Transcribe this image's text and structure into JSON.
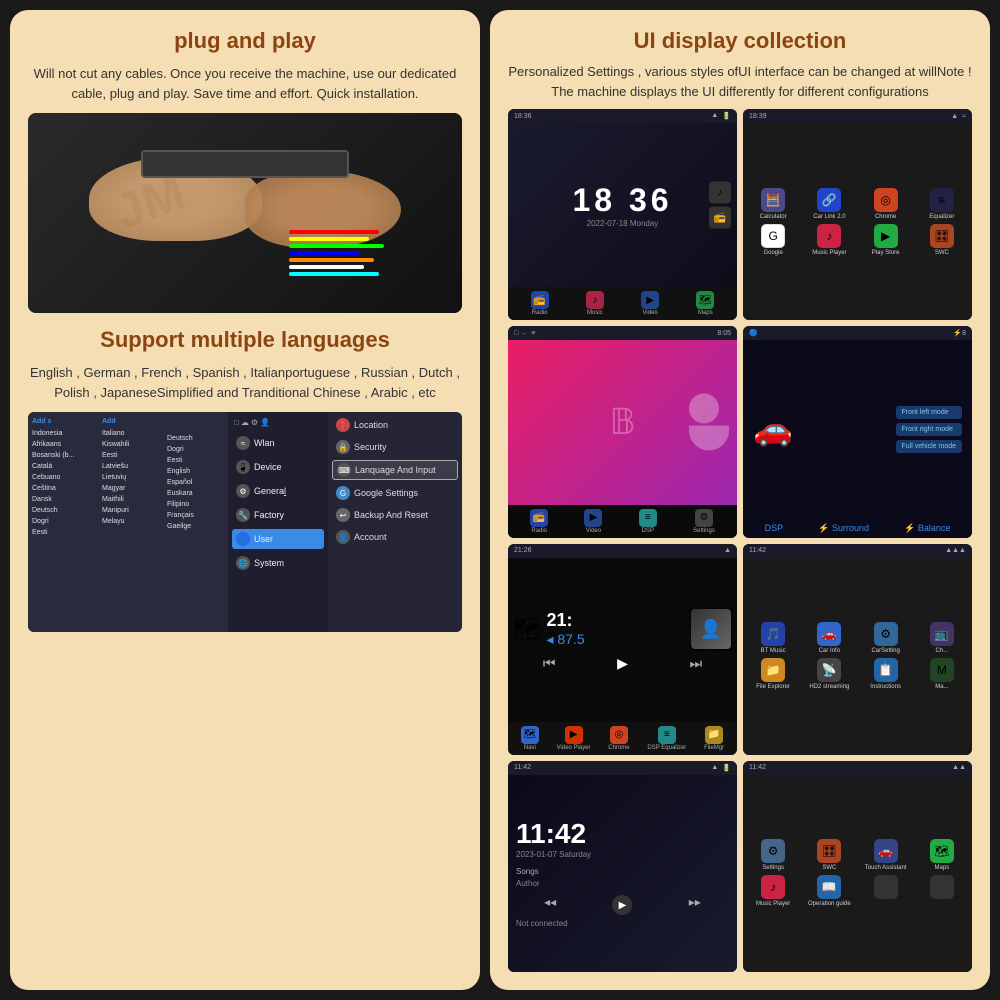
{
  "left_panel": {
    "section1_title": "plug and play",
    "section1_body": "Will not cut any cables. Once you receive the machine,\nuse our dedicated cable, plug and play.\nSave time and effort. Quick installation.",
    "section2_title": "Support multiple languages",
    "section2_body": "English , German , French , Spanish , Italianportuguese ,\nRussian , Dutch , Polish , JapaneseSimplified and\nTranditional Chinese , Arabic , etc",
    "settings_menu": {
      "left_items": [
        "Indonesia",
        "Afrikaans",
        "Bosanski (b",
        "Català",
        "Cebuano",
        "Čeština",
        "Dansk",
        "Deutsch",
        "Dogri"
      ],
      "left_items2": [
        "Italiano",
        "Kiswahili",
        "Eesti",
        "Latviešu",
        "Lietuvių",
        "Magyar",
        "Maithili",
        "Manipuri",
        "Melayu"
      ],
      "left_items3": [
        "Deutsch",
        "Dogri",
        "Eesti",
        "English",
        "Español",
        "Euskara",
        "Filipino",
        "Français",
        "Gaeilge"
      ],
      "add_label": "Add",
      "add_label2": "Add s",
      "mid_items": [
        {
          "icon": "wifi",
          "label": "Wlan",
          "active": false
        },
        {
          "icon": "device",
          "label": "Device",
          "active": false
        },
        {
          "icon": "gear",
          "label": "General",
          "active": false
        },
        {
          "icon": "wrench",
          "label": "Factory",
          "active": false
        },
        {
          "icon": "user",
          "label": "User",
          "active": true
        },
        {
          "icon": "globe",
          "label": "System",
          "active": false
        }
      ],
      "right_items": [
        {
          "icon": "📍",
          "label": "Location",
          "active": false
        },
        {
          "icon": "🔒",
          "label": "Security",
          "active": false
        },
        {
          "icon": "⌨️",
          "label": "Lanquage And Input",
          "active": true
        },
        {
          "icon": "🔧",
          "label": "Google Settings",
          "active": false
        },
        {
          "icon": "🔄",
          "label": "Backup And Reset",
          "active": false
        },
        {
          "icon": "👤",
          "label": "Account",
          "active": false
        }
      ]
    }
  },
  "right_panel": {
    "title": "UI display collection",
    "body": "Personalized Settings , various styles ofUI interface can be\nchanged at willNote !\nThe machine displays the UI differently for different\nconfigurations",
    "cells": [
      {
        "id": "clock1",
        "time": "18 36",
        "date": "2022-07-18  Monday",
        "type": "clock"
      },
      {
        "id": "apps1",
        "type": "appgrid",
        "time": "18:39"
      },
      {
        "id": "bluetooth",
        "type": "bt",
        "time": "8:05"
      },
      {
        "id": "carmode",
        "type": "car"
      },
      {
        "id": "music1",
        "type": "music",
        "time": "21:",
        "freq": "87.5",
        "time_full": "21:26"
      },
      {
        "id": "apps2",
        "type": "appgrid2",
        "time": "11:42"
      },
      {
        "id": "clock2",
        "type": "clock2",
        "time": "11:42",
        "date": "2023-01-07  Saturday"
      },
      {
        "id": "apps3",
        "type": "appgrid3",
        "time": "11:42"
      }
    ],
    "app_names": [
      "Radio",
      "Music",
      "Video",
      "Maps",
      "Google",
      "Music Player",
      "Play Store",
      "SWC"
    ],
    "bottom_nav": [
      "Navi",
      "Video Player",
      "Chrome",
      "DSP Equalizer",
      "FileManager"
    ],
    "bottom_nav2": [
      "File Explorer",
      "HD2 streaming",
      "Instructions",
      "Ma..."
    ],
    "dsp_bottom": [
      "Radio",
      "Video",
      "DSP",
      "Settings"
    ],
    "car_modes": [
      "Front left mode",
      "Front right mode",
      "Full vehicle mode"
    ],
    "music_apps": [
      "BT Music",
      "Car Info",
      "CarSetting",
      "Ch..."
    ],
    "music_apps2": [
      "Navi",
      "Video Player",
      "Chrome",
      "DSP Equalizer",
      "FileManager",
      "File Explorer",
      "HD2 streaming",
      "Instructions"
    ]
  },
  "colors": {
    "bg": "#1a1a1a",
    "panel_bg": "#f5deb3",
    "title": "#8B4513",
    "accent_blue": "#3a8ae8",
    "accent_red": "#e91e63"
  },
  "watermark": "JM"
}
